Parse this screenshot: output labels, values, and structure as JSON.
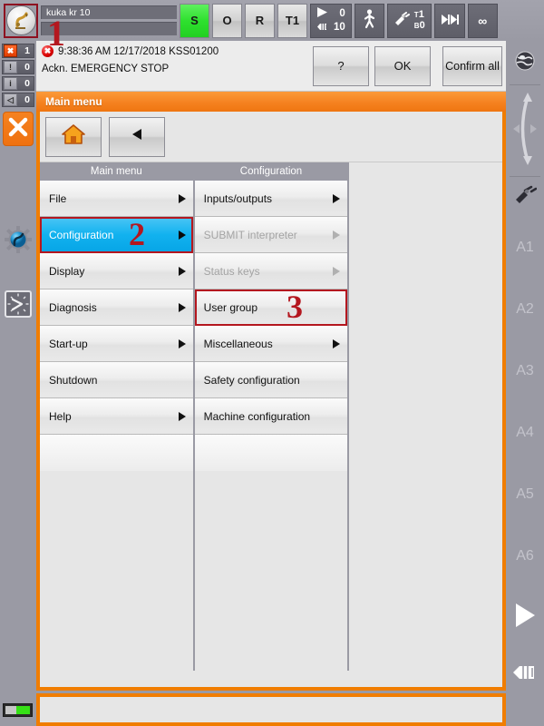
{
  "colors": {
    "accent_orange": "#f07d00",
    "selection_blue": "#12b2ef",
    "annotation_red": "#b4171f",
    "status_green": "#2ee02e",
    "bar_gray": "#9a9aa4"
  },
  "statusbar": {
    "robot_icon": "kuka-robot-icon",
    "robot_name": "kuka kr 10",
    "submit_field": "",
    "drives_state": "S",
    "drives_ready": "O",
    "robot_interpreter": "R",
    "operating_mode": "T1",
    "override_program": "0",
    "override_jog": "10",
    "play_icon": "play-triangle-icon",
    "hand_icon": "jog-hand-icon",
    "walking_icon": "walking-man-icon",
    "tool_icon": "tool-gripper-icon",
    "tool_label_top": "T",
    "tool_label_top_num": "1",
    "tool_label_bottom": "B",
    "tool_label_bottom_num": "0",
    "increment_icon": "increment-arrows-icon",
    "increment_value": "∞"
  },
  "message": {
    "severity_icon": "error-stop-icon",
    "timestamp": "9:38:36 AM 12/17/2018 KSS01200",
    "text": "Ackn. EMERGENCY STOP",
    "help_label": "?",
    "ok_label": "OK",
    "confirm_all_label": "Confirm all"
  },
  "leftbar": {
    "counters": [
      {
        "icon": "error-message-icon",
        "count": "1",
        "severity": "error"
      },
      {
        "icon": "warning-message-icon",
        "count": "0",
        "severity": "normal"
      },
      {
        "icon": "note-message-icon",
        "count": "0",
        "severity": "normal"
      },
      {
        "icon": "wait-message-icon",
        "count": "0",
        "severity": "normal"
      }
    ],
    "stop_button_icon": "stop-x-icon",
    "robot_gear_icon": "robot-gear-icon",
    "clock_icon": "clock-icon",
    "battery_icon": "battery-indicator-icon"
  },
  "rightbar": {
    "globe_icon": "world-coordinate-globe-icon",
    "coord_icon": "coordinate-jog-arrows-icon",
    "tool_icon": "tool-jog-icon",
    "axes": [
      "A1",
      "A2",
      "A3",
      "A4",
      "A5",
      "A6"
    ],
    "play_icon": "play-triangle-icon",
    "hand_icon": "jog-hand-icon"
  },
  "window": {
    "title": "Main menu",
    "home_button_icon": "home-icon",
    "back_button_icon": "back-arrow-icon"
  },
  "columns": [
    {
      "header": "Main menu",
      "items": [
        {
          "label": "File",
          "arrow": true,
          "state": "normal"
        },
        {
          "label": "Configuration",
          "arrow": true,
          "state": "selected",
          "highlight": true
        },
        {
          "label": "Display",
          "arrow": true,
          "state": "normal"
        },
        {
          "label": "Diagnosis",
          "arrow": true,
          "state": "normal"
        },
        {
          "label": "Start-up",
          "arrow": true,
          "state": "normal"
        },
        {
          "label": "Shutdown",
          "arrow": false,
          "state": "normal"
        },
        {
          "label": "Help",
          "arrow": true,
          "state": "normal"
        }
      ]
    },
    {
      "header": "Configuration",
      "items": [
        {
          "label": "Inputs/outputs",
          "arrow": true,
          "state": "normal"
        },
        {
          "label": "SUBMIT interpreter",
          "arrow": true,
          "state": "disabled"
        },
        {
          "label": "Status keys",
          "arrow": true,
          "state": "disabled"
        },
        {
          "label": "User group",
          "arrow": false,
          "state": "normal",
          "highlight": true
        },
        {
          "label": "Miscellaneous",
          "arrow": true,
          "state": "normal"
        },
        {
          "label": "Safety configuration",
          "arrow": false,
          "state": "normal"
        },
        {
          "label": "Machine configuration",
          "arrow": false,
          "state": "normal"
        }
      ]
    }
  ],
  "annotations": [
    {
      "number": "1",
      "target": "robot-badge"
    },
    {
      "number": "2",
      "target": "configuration-menu-item"
    },
    {
      "number": "3",
      "target": "user-group-menu-item"
    }
  ]
}
